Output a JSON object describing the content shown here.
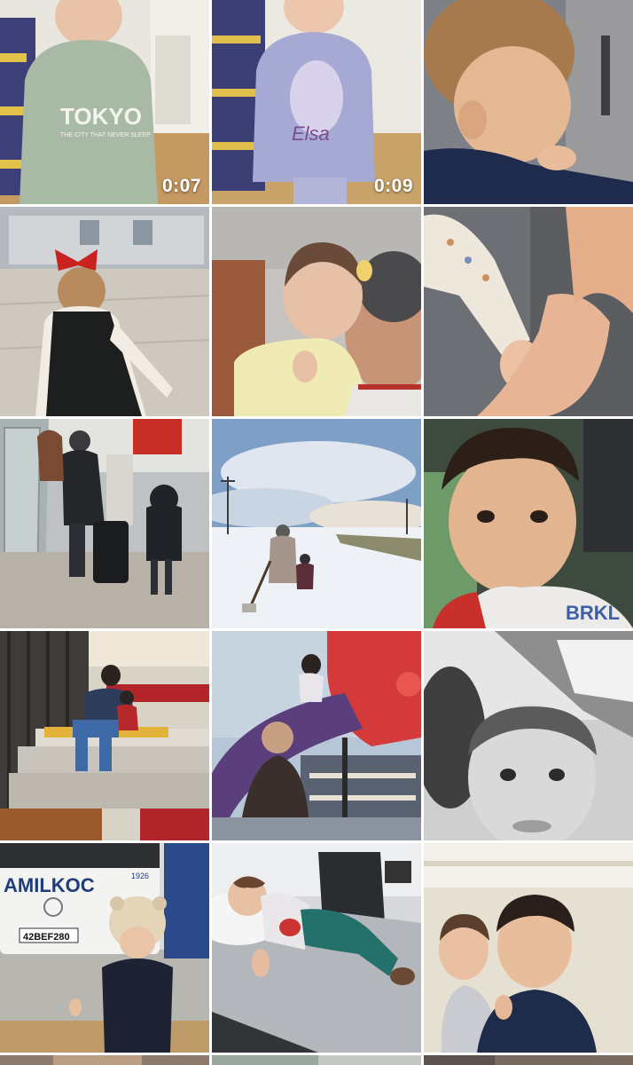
{
  "gallery": {
    "tiles": [
      {
        "duration": "0:07",
        "hoodie_text": "TOKYO",
        "hoodie_sub": "THE CITY THAT NEVER SLEEP"
      },
      {
        "duration": "0:09",
        "shirt_text": "Elsa"
      },
      {},
      {},
      {},
      {},
      {},
      {},
      {
        "shirt_text": "BRKL"
      },
      {},
      {},
      {},
      {
        "bus_brand": "AMILKOC",
        "bus_year": "1926",
        "plate": "42BEF280"
      },
      {},
      {},
      {},
      {},
      {}
    ]
  }
}
